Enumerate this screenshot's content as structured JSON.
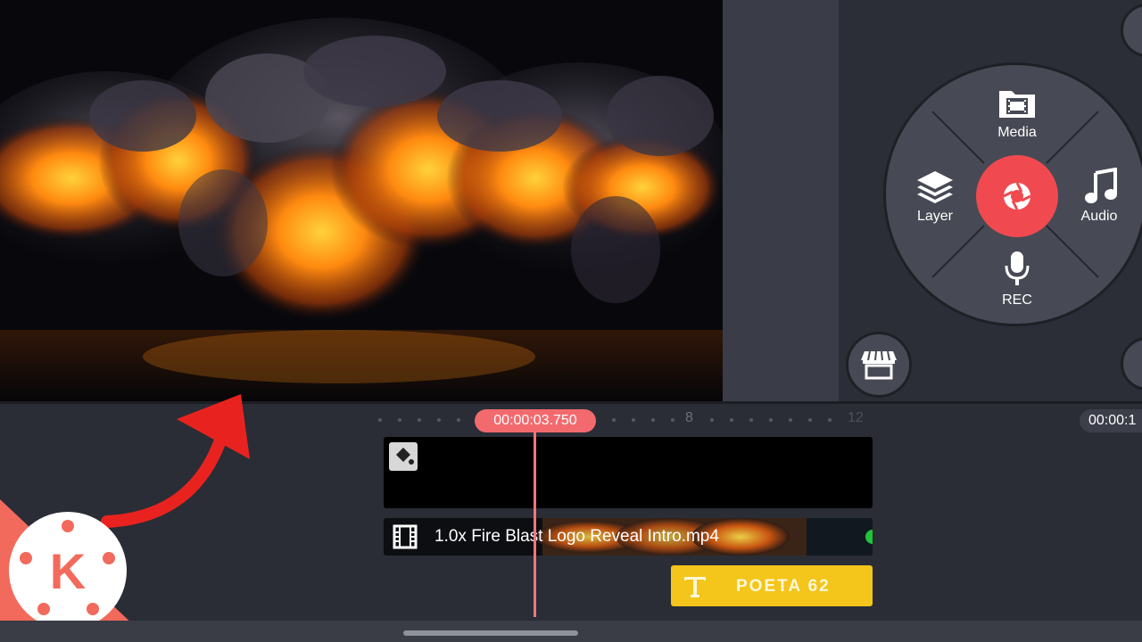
{
  "wheel": {
    "media_label": "Media",
    "layer_label": "Layer",
    "audio_label": "Audio",
    "rec_label": "REC"
  },
  "timeline": {
    "current_time": "00:00:03.750",
    "end_time": "00:00:1",
    "ruler_marks": [
      "8",
      "12"
    ]
  },
  "tracks": {
    "video_clip_label": "1.0x Fire Blast Logo Reveal Intro.mp4",
    "text_clip_label": "POETA 62"
  },
  "logo": {
    "letter": "K"
  },
  "colors": {
    "accent_red": "#f04a50",
    "playhead": "#f3767a",
    "text_layer": "#f4c51a",
    "panel": "#2b2e36"
  },
  "icons": [
    "media-icon",
    "layer-icon",
    "audio-icon",
    "rec-mic-icon",
    "camera-shutter-icon",
    "store-icon",
    "fill-bucket-icon",
    "film-icon",
    "text-t-icon"
  ]
}
